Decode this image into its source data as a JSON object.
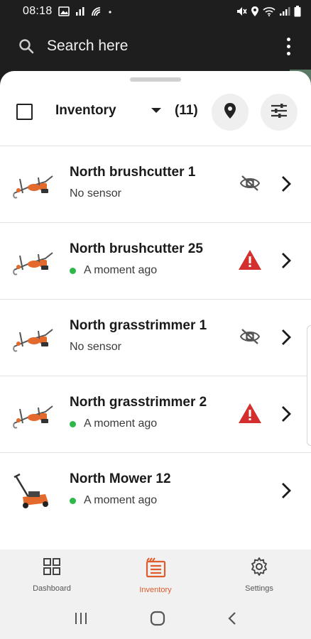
{
  "status_bar": {
    "time": "08:18",
    "left_icons": [
      "image-icon",
      "signal-bars-icon",
      "broadcast-icon",
      "dot-icon"
    ],
    "right_icons": [
      "mute-icon",
      "location-icon",
      "wifi-icon",
      "cell-signal-icon",
      "battery-icon"
    ]
  },
  "search": {
    "placeholder": "Search here"
  },
  "toolbar": {
    "title": "Inventory",
    "count": "(11)"
  },
  "items": [
    {
      "title": "North brushcutter 1",
      "subtitle": "No sensor",
      "online": false,
      "status": "no-sensor",
      "thumb": "brushcutter"
    },
    {
      "title": "North brushcutter 25",
      "subtitle": "A moment ago",
      "online": true,
      "status": "warning",
      "thumb": "brushcutter"
    },
    {
      "title": "North grasstrimmer 1",
      "subtitle": "No sensor",
      "online": false,
      "status": "no-sensor",
      "thumb": "brushcutter"
    },
    {
      "title": "North grasstrimmer 2",
      "subtitle": "A moment ago",
      "online": true,
      "status": "warning",
      "thumb": "brushcutter"
    },
    {
      "title": "North Mower 12",
      "subtitle": "A moment ago",
      "online": true,
      "status": "none",
      "thumb": "mower"
    }
  ],
  "bottom_nav": [
    {
      "label": "Dashboard",
      "icon": "dashboard-grid-icon",
      "active": false
    },
    {
      "label": "Inventory",
      "icon": "inventory-list-icon",
      "active": true
    },
    {
      "label": "Settings",
      "icon": "settings-gear-icon",
      "active": false
    }
  ],
  "colors": {
    "accent": "#e05a2b",
    "online": "#2fb84a",
    "warning": "#d32f2f",
    "dark_bar": "#1e1e1e"
  }
}
